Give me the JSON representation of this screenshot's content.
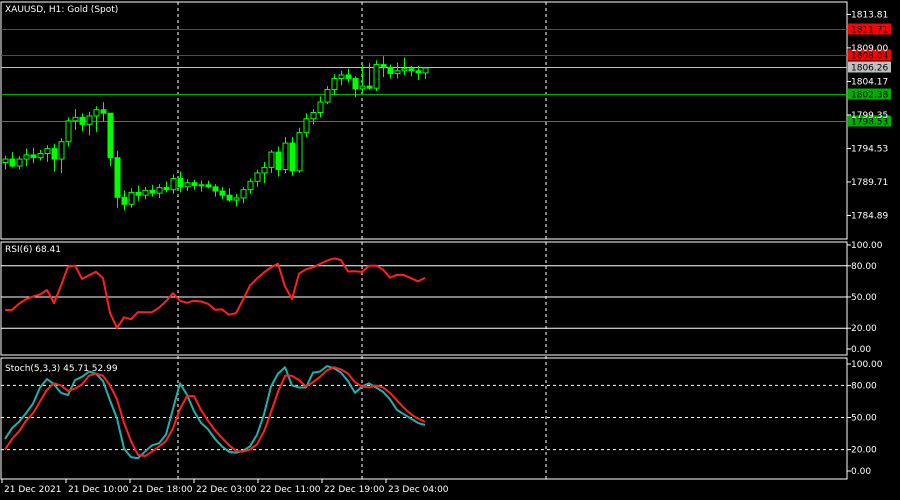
{
  "colors": {
    "background": "#000000",
    "frame": "#ffffff",
    "candle": "#00ff00",
    "resistance": "#ff0000",
    "support": "#00b000",
    "current": "#c0c0c0",
    "rsi": "#ff2020",
    "stoch_main": "#20b2aa",
    "stoch_signal": "#ff2020",
    "text": "#ffffff"
  },
  "chart_data": [
    {
      "type": "candlestick",
      "title": "XAUUSD, H1:  Gold (Spot)",
      "ylim": [
        1781.5,
        1815.6
      ],
      "yticks": [
        "1813.81",
        "1809.00",
        "1804.17",
        "1799.35",
        "1794.53",
        "1789.71",
        "1784.89"
      ],
      "xticks": [
        "21 Dec 2021",
        "21 Dec 10:00",
        "21 Dec 18:00",
        "22 Dec 03:00",
        "22 Dec 11:00",
        "22 Dec 19:00",
        "23 Dec 04:00"
      ],
      "level_lines": [
        {
          "price": 1811.71,
          "label": "1811.71",
          "kind": "resistance"
        },
        {
          "price": 1808.04,
          "label": "1808.04",
          "kind": "resistance"
        },
        {
          "price": 1806.26,
          "label": "1806.26",
          "kind": "current"
        },
        {
          "price": 1802.38,
          "label": "1802.38",
          "kind": "support"
        },
        {
          "price": 1798.53,
          "label": "1798.53",
          "kind": "support"
        }
      ],
      "candles": [
        [
          1792.5,
          1793.5,
          1791.5,
          1793.0
        ],
        [
          1793.0,
          1794.0,
          1791.8,
          1792.0
        ],
        [
          1792.0,
          1793.4,
          1791.5,
          1793.0
        ],
        [
          1793.0,
          1794.5,
          1792.0,
          1793.6
        ],
        [
          1793.6,
          1794.6,
          1792.4,
          1793.2
        ],
        [
          1793.2,
          1794.3,
          1792.8,
          1793.8
        ],
        [
          1793.8,
          1795.0,
          1792.6,
          1794.5
        ],
        [
          1794.5,
          1795.2,
          1791.2,
          1793.0
        ],
        [
          1793.0,
          1796.0,
          1791.0,
          1795.5
        ],
        [
          1795.5,
          1799.0,
          1794.8,
          1798.5
        ],
        [
          1798.5,
          1800.2,
          1797.2,
          1799.0
        ],
        [
          1799.0,
          1799.6,
          1797.0,
          1798.0
        ],
        [
          1798.0,
          1799.8,
          1796.4,
          1799.2
        ],
        [
          1799.2,
          1800.6,
          1796.9,
          1800.1
        ],
        [
          1800.1,
          1801.2,
          1798.4,
          1799.6
        ],
        [
          1799.6,
          1799.6,
          1792.0,
          1793.2
        ],
        [
          1793.2,
          1794.2,
          1786.0,
          1787.5
        ],
        [
          1787.5,
          1788.5,
          1785.6,
          1786.5
        ],
        [
          1786.5,
          1788.8,
          1786.0,
          1788.2
        ],
        [
          1788.2,
          1789.2,
          1787.0,
          1787.8
        ],
        [
          1787.8,
          1789.0,
          1787.2,
          1788.5
        ],
        [
          1788.5,
          1789.3,
          1787.6,
          1788.1
        ],
        [
          1788.1,
          1789.4,
          1787.4,
          1788.9
        ],
        [
          1788.9,
          1789.8,
          1788.2,
          1788.6
        ],
        [
          1788.6,
          1790.8,
          1788.0,
          1790.2
        ],
        [
          1790.2,
          1791.2,
          1788.2,
          1789.0
        ],
        [
          1789.0,
          1790.1,
          1788.4,
          1789.6
        ],
        [
          1789.6,
          1790.0,
          1788.6,
          1789.2
        ],
        [
          1789.2,
          1789.9,
          1788.3,
          1789.3
        ],
        [
          1789.3,
          1789.9,
          1788.8,
          1789.0
        ],
        [
          1789.0,
          1789.4,
          1787.6,
          1788.4
        ],
        [
          1788.4,
          1789.0,
          1787.2,
          1787.8
        ],
        [
          1787.8,
          1788.8,
          1786.9,
          1787.1
        ],
        [
          1787.1,
          1788.0,
          1786.2,
          1787.4
        ],
        [
          1787.4,
          1789.0,
          1786.6,
          1788.6
        ],
        [
          1788.6,
          1790.2,
          1788.0,
          1789.8
        ],
        [
          1789.8,
          1791.5,
          1789.0,
          1791.0
        ],
        [
          1791.0,
          1792.6,
          1789.5,
          1791.8
        ],
        [
          1791.8,
          1794.3,
          1791.0,
          1794.0
        ],
        [
          1794.0,
          1794.8,
          1790.5,
          1791.5
        ],
        [
          1791.5,
          1796.2,
          1791.0,
          1795.3
        ],
        [
          1795.3,
          1796.2,
          1790.6,
          1791.3
        ],
        [
          1791.3,
          1797.5,
          1791.0,
          1796.8
        ],
        [
          1796.8,
          1799.6,
          1796.2,
          1798.8
        ],
        [
          1798.8,
          1800.2,
          1798.0,
          1799.7
        ],
        [
          1799.7,
          1802.0,
          1799.0,
          1801.2
        ],
        [
          1801.2,
          1803.5,
          1800.9,
          1803.0
        ],
        [
          1803.0,
          1805.2,
          1802.2,
          1804.6
        ],
        [
          1804.6,
          1805.7,
          1803.6,
          1805.1
        ],
        [
          1805.1,
          1806.0,
          1804.0,
          1804.6
        ],
        [
          1804.6,
          1804.9,
          1801.9,
          1803.1
        ],
        [
          1803.1,
          1806.6,
          1802.6,
          1803.5
        ],
        [
          1803.5,
          1806.8,
          1803.0,
          1803.2
        ],
        [
          1803.2,
          1807.2,
          1802.8,
          1806.6
        ],
        [
          1806.6,
          1807.8,
          1804.8,
          1806.2
        ],
        [
          1806.2,
          1806.6,
          1804.6,
          1805.3
        ],
        [
          1805.3,
          1806.9,
          1804.6,
          1805.7
        ],
        [
          1805.7,
          1807.6,
          1805.1,
          1806.0
        ],
        [
          1806.0,
          1806.4,
          1804.9,
          1805.7
        ],
        [
          1805.7,
          1806.4,
          1804.4,
          1805.4
        ],
        [
          1805.4,
          1806.2,
          1804.5,
          1806.1
        ]
      ]
    },
    {
      "type": "line",
      "title": "RSI(6) 68.41",
      "ylim": [
        0,
        100
      ],
      "yticks": [
        100,
        80,
        50,
        20,
        0
      ],
      "series": [
        {
          "values": [
            37.5,
            37.6,
            43.6,
            47.9,
            50.5,
            52.4,
            56.7,
            44.1,
            61.0,
            79.1,
            80.2,
            67.4,
            71.0,
            74.2,
            68.1,
            34.7,
            20.3,
            30.5,
            28.7,
            35.5,
            35.3,
            35.5,
            39.7,
            46.0,
            53.7,
            46.3,
            44.4,
            46.4,
            45.7,
            43.5,
            37.7,
            38.1,
            33.0,
            34.5,
            47.3,
            61.0,
            67.8,
            73.7,
            78.6,
            82.0,
            60.2,
            48.0,
            72.5,
            76.6,
            78.6,
            81.7,
            85.0,
            87.1,
            85.6,
            74.5,
            74.8,
            74.1,
            80.1,
            80.2,
            76.3,
            68.6,
            71.3,
            71.2,
            68.1,
            65.0,
            68.4
          ]
        }
      ]
    },
    {
      "type": "line",
      "title": "Stoch(5,3,3) 45.71 52.99",
      "ylim": [
        0,
        100
      ],
      "yticks": [
        100,
        80,
        50,
        20,
        0
      ],
      "series": [
        {
          "values": [
            30,
            40,
            46,
            54,
            63,
            78,
            86,
            81,
            73,
            71,
            85,
            88,
            93,
            91,
            84,
            66,
            49,
            21,
            13,
            12,
            18,
            24,
            26,
            34,
            58,
            82,
            71,
            56,
            45,
            39,
            30,
            23,
            18,
            17,
            19,
            23,
            34,
            53,
            79,
            91,
            97,
            80,
            78,
            78,
            92,
            93,
            98,
            96,
            92,
            84,
            73,
            79,
            82,
            78,
            74,
            67,
            57,
            53,
            49,
            45,
            43
          ]
        },
        {
          "values": [
            20,
            30,
            37,
            47,
            54,
            65,
            76,
            82,
            80,
            75,
            77,
            81,
            89,
            91,
            89,
            80,
            67,
            45,
            28,
            15,
            14,
            18,
            23,
            28,
            40,
            58,
            70,
            70,
            57,
            47,
            38,
            31,
            24,
            19,
            18,
            20,
            25,
            37,
            55,
            74,
            89,
            89,
            85,
            79,
            83,
            88,
            94,
            97,
            95,
            91,
            83,
            79,
            78,
            80,
            78,
            73,
            66,
            59,
            53,
            49,
            46
          ]
        }
      ]
    }
  ]
}
